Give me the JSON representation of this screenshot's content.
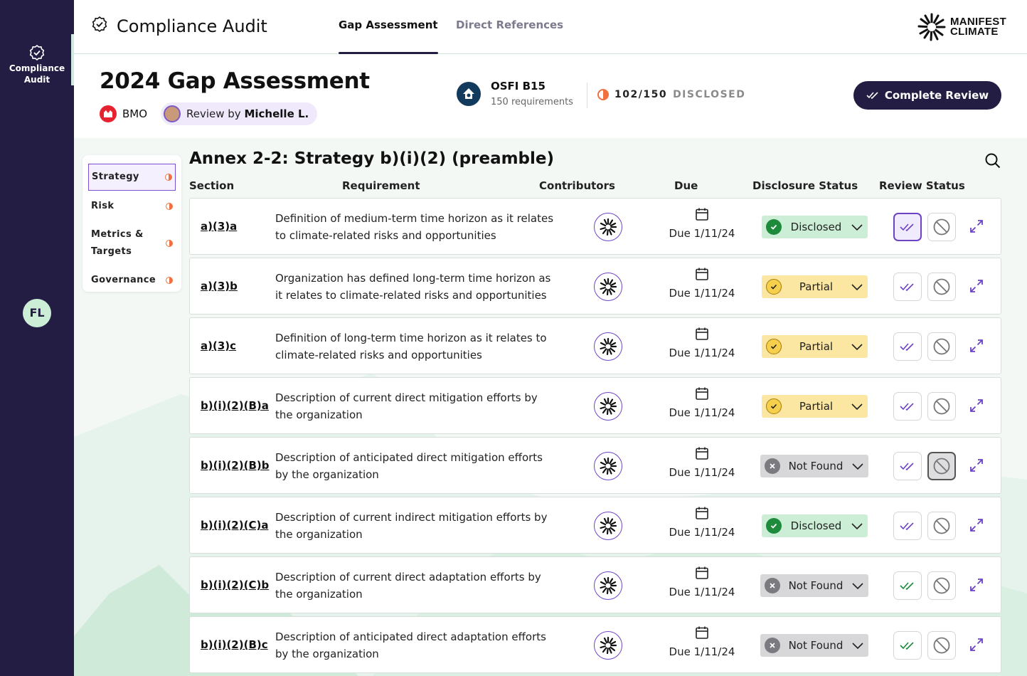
{
  "rail": {
    "item_label_line1": "Compliance",
    "item_label_line2": "Audit",
    "avatar_initials": "FL"
  },
  "topbar": {
    "app_title": "Compliance Audit",
    "tabs": [
      {
        "label": "Gap Assessment",
        "active": true
      },
      {
        "label": "Direct References",
        "active": false
      }
    ],
    "logo_line1": "MANIFEST",
    "logo_line2": "CLIMATE"
  },
  "header": {
    "title": "2024 Gap Assessment",
    "org": "BMO",
    "review_prefix": "Review by",
    "reviewer": "Michelle L.",
    "framework_name": "OSFI B15",
    "framework_sub": "150 requirements",
    "disclosed_count": "102/150",
    "disclosed_word": "DISCLOSED",
    "complete_label": "Complete Review"
  },
  "side_nav": {
    "items": [
      {
        "label": "Strategy",
        "active": true
      },
      {
        "label": "Risk",
        "active": false
      },
      {
        "label": "Metrics &",
        "label2": "Targets",
        "active": false
      },
      {
        "label": "Governance",
        "active": false
      }
    ]
  },
  "table": {
    "section_title": "Annex 2-2: Strategy b)(i)(2) (preamble)",
    "columns": {
      "section": "Section",
      "requirement": "Requirement",
      "contributors": "Contributors",
      "due": "Due",
      "disclosure": "Disclosure Status",
      "review": "Review Status"
    },
    "rows": [
      {
        "section": "a)(3)a",
        "req1": "Definition of medium-term time horizon as it relates",
        "req2": "to climate-related risks and opportunities",
        "due": "Due 1/11/24",
        "status": "Disclosed",
        "review": "approved"
      },
      {
        "section": "a)(3)b",
        "req1": "Organization has defined long-term time horizon as",
        "req2": "it relates to climate-related risks and opportunities",
        "due": "Due 1/11/24",
        "status": "Partial",
        "review": "none"
      },
      {
        "section": "a)(3)c",
        "req1": "Definition of long-term time horizon as it relates to",
        "req2": "climate-related risks and opportunities",
        "due": "Due 1/11/24",
        "status": "Partial",
        "review": "none"
      },
      {
        "section": "b)(i)(2)(B)a",
        "req1": "Description of current direct mitigation efforts by",
        "req2": "the organization",
        "due": "Due 1/11/24",
        "status": "Partial",
        "review": "none"
      },
      {
        "section": "b)(i)(2)(B)b",
        "req1": "Description of anticipated direct mitigation efforts",
        "req2": "by the organization",
        "due": "Due 1/11/24",
        "status": "Not Found",
        "review": "rejected"
      },
      {
        "section": "b)(i)(2)(C)a",
        "req1": "Description of current indirect mitigation efforts by",
        "req2": "the organization",
        "due": "Due 1/11/24",
        "status": "Disclosed",
        "review": "none"
      },
      {
        "section": "b)(i)(2)(C)b",
        "req1": "Description of current direct adaptation efforts by",
        "req2": "the organization",
        "due": "Due 1/11/24",
        "status": "Not Found",
        "review": "none"
      },
      {
        "section": "b)(i)(2)(B)c",
        "req1": "Description of anticipated direct adaptation efforts",
        "req2": "by the organization",
        "due": "Due 1/11/24",
        "status": "Not Found",
        "review": "none"
      }
    ]
  },
  "colors": {
    "rail": "#231c43",
    "accent_purple": "#6d43c4",
    "disclosed_bg": "#cdeed6",
    "partial_bg": "#fbe6a2",
    "notfound_bg": "#d7d7d9"
  }
}
